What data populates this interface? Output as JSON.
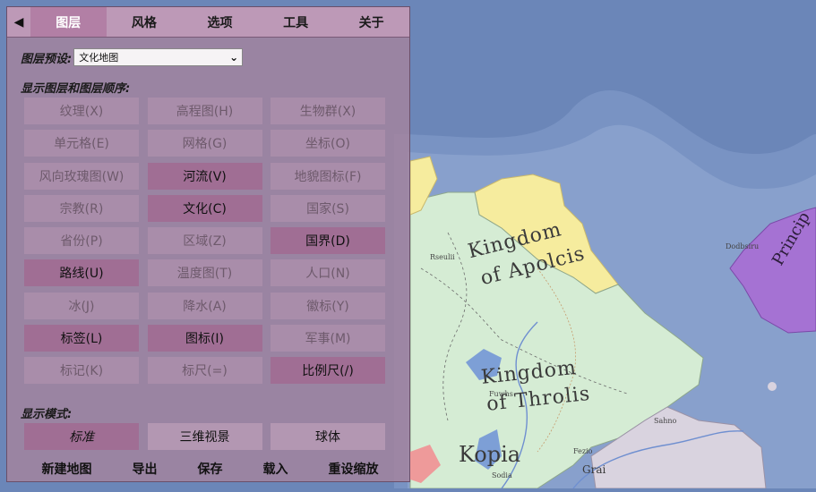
{
  "map": {
    "labels": {
      "kingdom_apolcis_1": "Kingdom",
      "kingdom_apolcis_2": "of Apolcis",
      "kingdom_throlis_1": "Kingdom",
      "kingdom_throlis_2": "of Throlis",
      "kopia": "Kopia",
      "princip": "Princip",
      "town_rseuliii": "Rseulii",
      "town_dodbsiru": "Dodbsiru",
      "town_sahno": "Sahno",
      "town_fuwhs": "Fuwhs",
      "town_fezio": "Fezio",
      "town_sodia": "Sodia",
      "grai": "Grai"
    },
    "colors": {
      "ocean": "#6b86b8",
      "shallow": "#8aa2cc",
      "throlis": "#d5ecd4",
      "apolcis": "#f6ec9e",
      "princip": "#a572d3",
      "grey_state": "#d9d3df",
      "lake": "#7d9fd6",
      "red_state": "#ee9a9a"
    }
  },
  "tabs": {
    "collapse": "◀",
    "items": [
      "图层",
      "风格",
      "选项",
      "工具",
      "关于"
    ],
    "active": 0
  },
  "preset": {
    "label": "图层预设:",
    "value": "文化地图"
  },
  "layers_title": "显示图层和图层顺序:",
  "layers": [
    {
      "label": "纹理(X)",
      "on": false
    },
    {
      "label": "高程图(H)",
      "on": false
    },
    {
      "label": "生物群(X)",
      "on": false
    },
    {
      "label": "单元格(E)",
      "on": false
    },
    {
      "label": "网格(G)",
      "on": false
    },
    {
      "label": "坐标(O)",
      "on": false
    },
    {
      "label": "风向玫瑰图(W)",
      "on": false
    },
    {
      "label": "河流(V)",
      "on": true
    },
    {
      "label": "地貌图标(F)",
      "on": false
    },
    {
      "label": "宗教(R)",
      "on": false
    },
    {
      "label": "文化(C)",
      "on": true
    },
    {
      "label": "国家(S)",
      "on": false
    },
    {
      "label": "省份(P)",
      "on": false
    },
    {
      "label": "区域(Z)",
      "on": false
    },
    {
      "label": "国界(D)",
      "on": true
    },
    {
      "label": "路线(U)",
      "on": true
    },
    {
      "label": "温度图(T)",
      "on": false
    },
    {
      "label": "人口(N)",
      "on": false
    },
    {
      "label": "冰(J)",
      "on": false
    },
    {
      "label": "降水(A)",
      "on": false
    },
    {
      "label": "徽标(Y)",
      "on": false
    },
    {
      "label": "标签(L)",
      "on": true
    },
    {
      "label": "图标(I)",
      "on": true
    },
    {
      "label": "军事(M)",
      "on": false
    },
    {
      "label": "标记(K)",
      "on": false
    },
    {
      "label": "标尺(=)",
      "on": false
    },
    {
      "label": "比例尺(/)",
      "on": true
    }
  ],
  "mode_title": "显示模式:",
  "modes": [
    {
      "label": "标准",
      "on": true
    },
    {
      "label": "三维视景",
      "on": false
    },
    {
      "label": "球体",
      "on": false
    }
  ],
  "actions": [
    "新建地图",
    "导出",
    "保存",
    "载入",
    "重设缩放"
  ]
}
